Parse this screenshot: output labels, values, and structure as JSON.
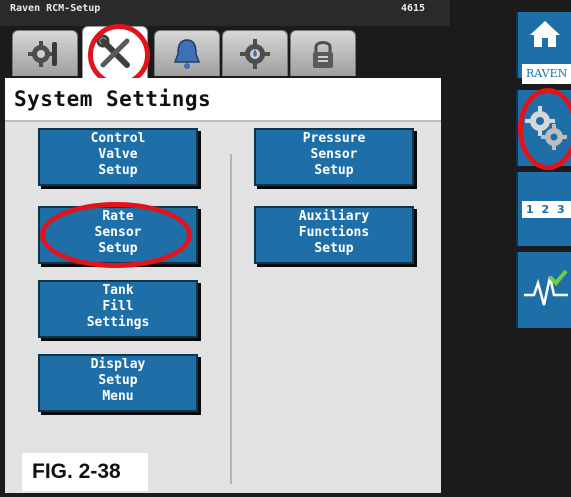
{
  "titlebar": {
    "app_name": "Raven RCM-Setup",
    "code": "4615"
  },
  "tabs": [
    {
      "icon": "gear-wrench-icon",
      "active": false
    },
    {
      "icon": "wrench-screwdriver-icon",
      "active": true
    },
    {
      "icon": "bell-icon",
      "active": false
    },
    {
      "icon": "gear-drop-icon",
      "active": false
    },
    {
      "icon": "lock-icon",
      "active": false
    }
  ],
  "panel": {
    "title": "System Settings",
    "left_buttons": [
      {
        "label": "Control\nValve\nSetup"
      },
      {
        "label": "Rate\nSensor\nSetup"
      },
      {
        "label": "Tank\nFill\nSettings"
      },
      {
        "label": "Display\nSetup\nMenu"
      }
    ],
    "right_buttons": [
      {
        "label": "Pressure\nSensor\nSetup"
      },
      {
        "label": "Auxiliary\nFunctions\nSetup"
      }
    ]
  },
  "sidebar": {
    "home_label": "RAVEN",
    "settings_icon": "gears-icon",
    "numbers_label": "1 2 3",
    "diagnostics_icon": "heartbeat-check-icon"
  },
  "figure_label": "FIG. 2-38",
  "colors": {
    "accent_blue": "#1e6fa8",
    "highlight_red": "#e2141b",
    "panel_bg": "#e2e2e2"
  }
}
